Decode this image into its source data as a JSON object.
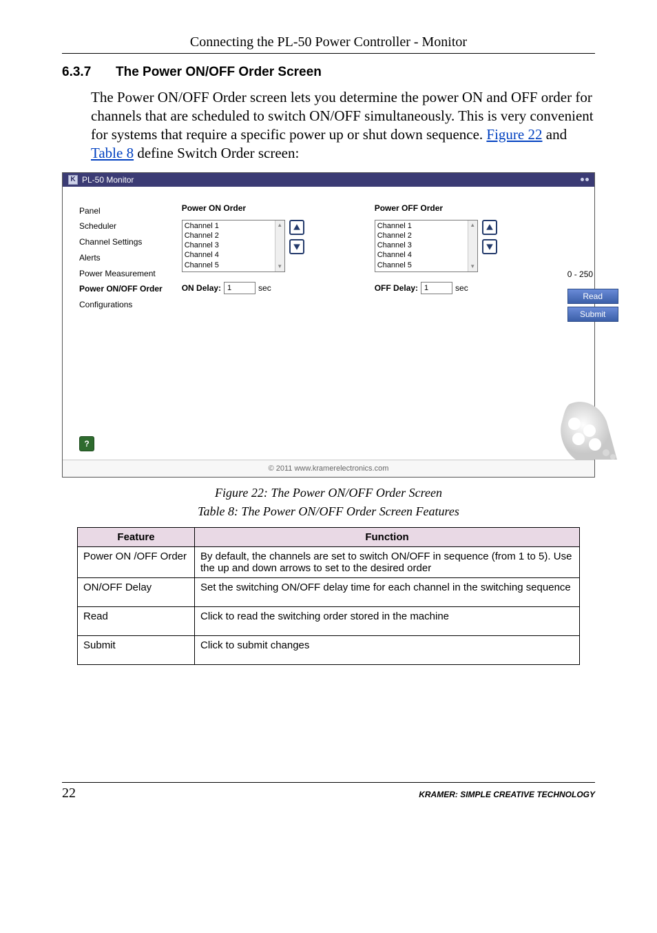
{
  "doc": {
    "running_header": "Connecting the PL-50 Power Controller - Monitor",
    "section_number": "6.3.7",
    "section_title": "The Power ON/OFF Order Screen",
    "paragraph_parts": {
      "p1": "The Power ON/OFF Order screen lets you determine the power ON and OFF order for channels that are scheduled to switch ON/OFF simultaneously. This is very convenient for systems that require a specific power up or shut down sequence. ",
      "link1": "Figure 22",
      "mid1": " and ",
      "link2": "Table 8",
      "tail": " define Switch Order screen:"
    },
    "figure_caption": "Figure 22: The Power ON/OFF Order Screen",
    "table_caption": "Table 8: The Power ON/OFF Order Screen Features",
    "table": {
      "headers": {
        "feature": "Feature",
        "function": "Function"
      },
      "rows": [
        {
          "feature": "Power ON /OFF Order",
          "function": "By default, the channels are set to switch ON/OFF in sequence (from 1 to 5). Use the up and down arrows to set to the desired order"
        },
        {
          "feature": "ON/OFF Delay",
          "function": "Set the switching ON/OFF delay time for each channel in the switching sequence"
        },
        {
          "feature": "Read",
          "function": "Click to read the switching order stored in the machine"
        },
        {
          "feature": "Submit",
          "function": "Click to submit changes"
        }
      ]
    },
    "page_number": "22",
    "footer_tag": "KRAMER:  Simple Creative Technology"
  },
  "app": {
    "title": "PL-50 Monitor",
    "title_icon_letter": "K",
    "sidebar": {
      "items": [
        {
          "label": "Panel"
        },
        {
          "label": "Scheduler"
        },
        {
          "label": "Channel Settings"
        },
        {
          "label": "Alerts"
        },
        {
          "label": "Power Measurement"
        },
        {
          "label": "Power ON/OFF Order"
        },
        {
          "label": "Configurations"
        }
      ],
      "active_index": 5
    },
    "on_order": {
      "title": "Power ON Order",
      "items": [
        "Channel 1",
        "Channel 2",
        "Channel 3",
        "Channel 4",
        "Channel 5"
      ],
      "delay_label": "ON Delay:",
      "delay_value": "1",
      "delay_unit": "sec"
    },
    "off_order": {
      "title": "Power OFF Order",
      "items": [
        "Channel 1",
        "Channel 2",
        "Channel 3",
        "Channel 4",
        "Channel 5"
      ],
      "delay_label": "OFF Delay:",
      "delay_value": "1",
      "delay_unit": "sec"
    },
    "delay_range": "0 - 250",
    "buttons": {
      "read": "Read",
      "submit": "Submit"
    },
    "help_glyph": "?",
    "footer": "© 2011 www.kramerelectronics.com"
  }
}
